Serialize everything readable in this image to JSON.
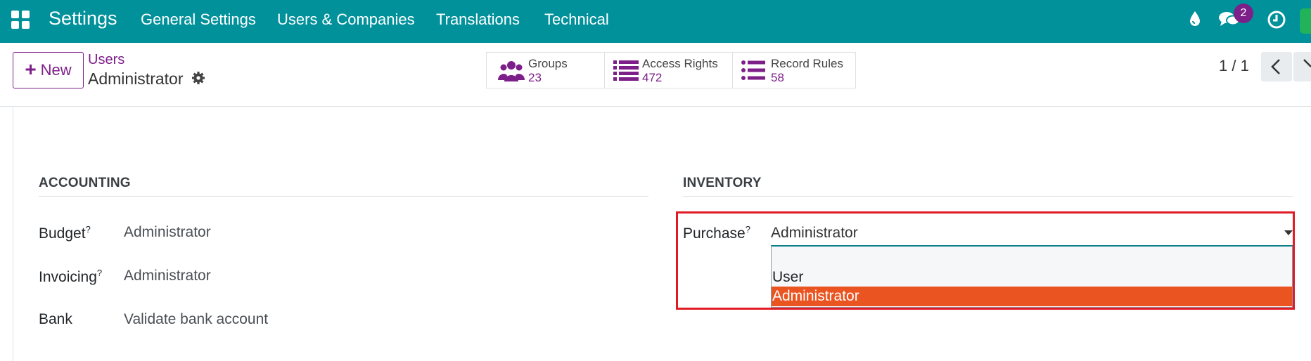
{
  "navbar": {
    "brand": "Settings",
    "menu": [
      "General Settings",
      "Users & Companies",
      "Translations",
      "Technical"
    ],
    "icons": [
      "apps-grid-icon",
      "debug-drop-icon",
      "discuss-chat-icon",
      "activity-clock-icon"
    ],
    "notification_count": "2",
    "color": "#00919b"
  },
  "control_panel": {
    "new_label": "New",
    "breadcrumb_parent": "Users",
    "breadcrumb_current": "Administrator",
    "smart_buttons": [
      {
        "label": "Groups",
        "value": "23",
        "icon": "users-group-icon"
      },
      {
        "label": "Access Rights",
        "value": "472",
        "icon": "list-icon"
      },
      {
        "label": "Record Rules",
        "value": "58",
        "icon": "list-icon"
      }
    ],
    "pager": "1 / 1"
  },
  "accounting": {
    "title": "ACCOUNTING",
    "fields": [
      {
        "label": "Budget",
        "help": "?",
        "value": "Administrator"
      },
      {
        "label": "Invoicing",
        "help": "?",
        "value": "Administrator"
      },
      {
        "label": "Bank",
        "help": "",
        "value": "Validate bank account"
      }
    ]
  },
  "inventory": {
    "title": "INVENTORY",
    "purchase": {
      "label": "Purchase",
      "help": "?",
      "value": "Administrator",
      "options": [
        "",
        "User",
        "Administrator"
      ],
      "selected": "Administrator"
    }
  },
  "colors": {
    "accent": "#7d1f89",
    "highlight": "#e01b24",
    "selected_option": "#e95420"
  }
}
